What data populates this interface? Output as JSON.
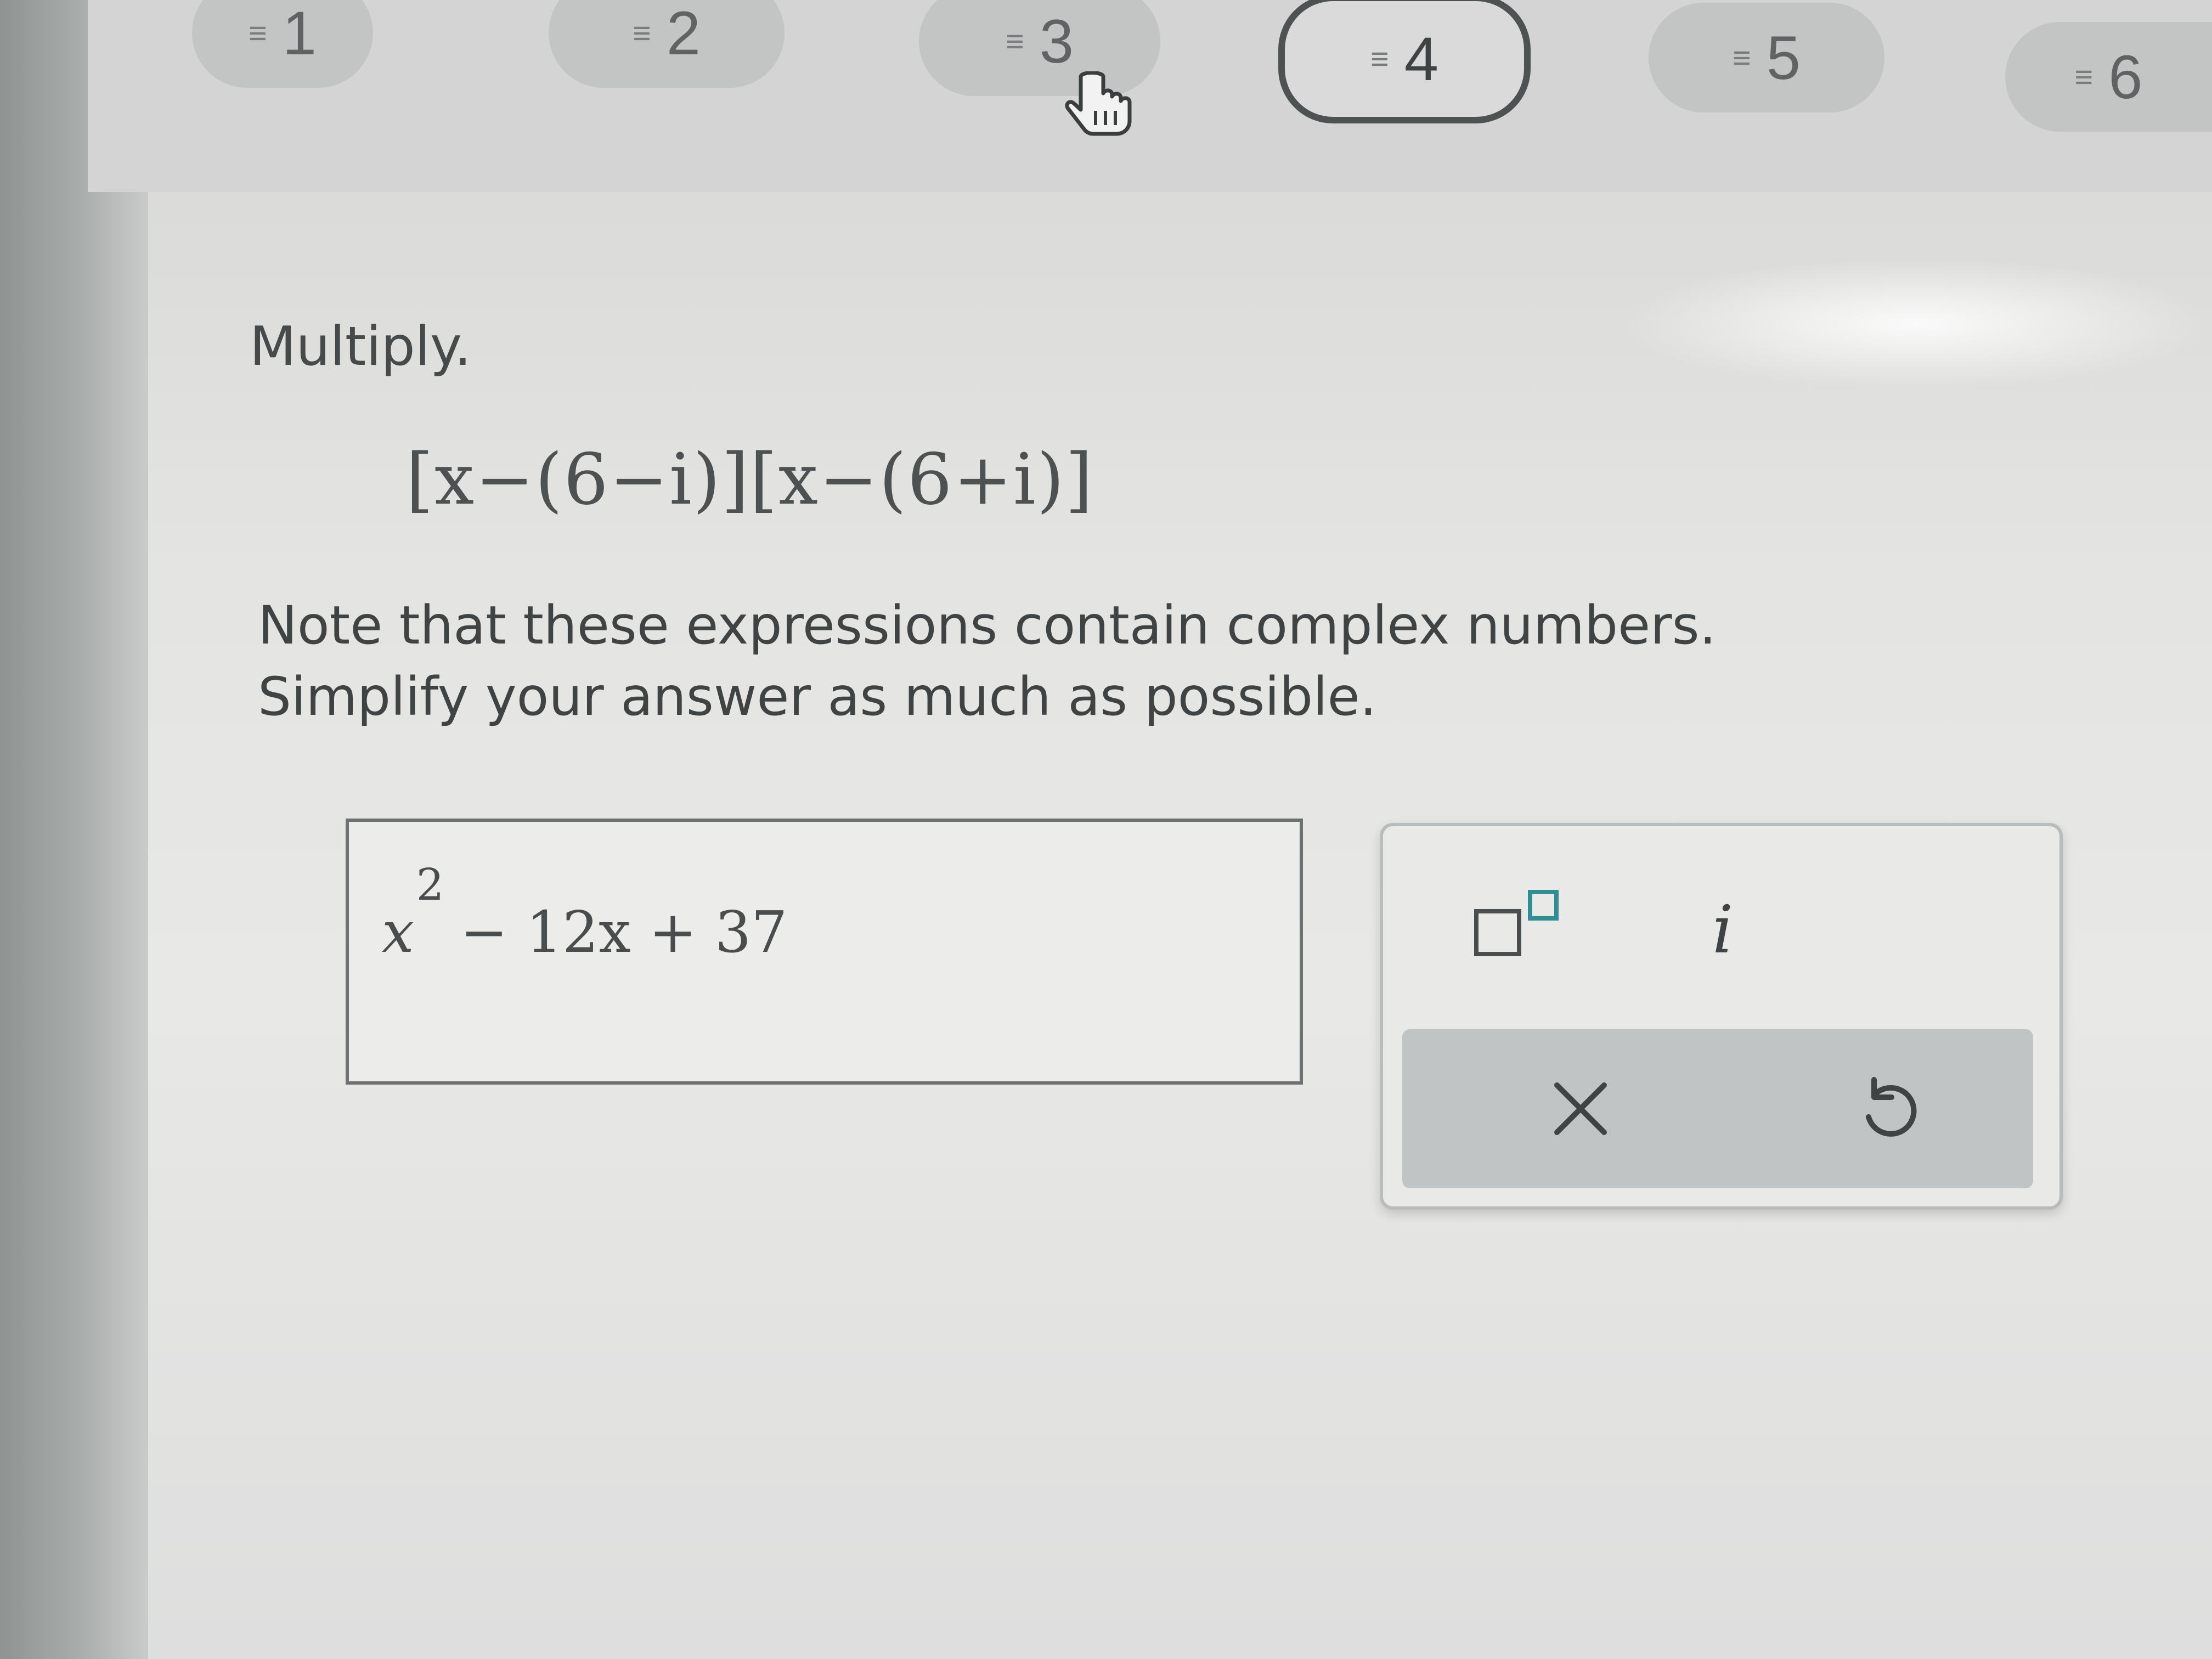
{
  "question_nav": {
    "items": [
      {
        "lines_icon": "≡",
        "number": "1"
      },
      {
        "lines_icon": "≡",
        "number": "2"
      },
      {
        "lines_icon": "≡",
        "number": "3"
      },
      {
        "lines_icon": "≡",
        "number": "4"
      },
      {
        "lines_icon": "≡",
        "number": "5"
      },
      {
        "lines_icon": "≡",
        "number": "6"
      }
    ],
    "active": "4"
  },
  "question": {
    "prompt": "Multiply.",
    "expression": "[x−(6−i)][x−(6+i)]",
    "note_line1": "Note that these expressions contain complex numbers.",
    "note_line2": "Simplify your answer as much as possible."
  },
  "answer": {
    "base": "x",
    "exponent": "2",
    "rest": " − 12x + 37"
  },
  "toolpad": {
    "imaginary_label": "i",
    "icons": [
      "superscript-template-icon",
      "clear-x-icon",
      "undo-icon",
      "hand-pointer-icon"
    ]
  },
  "colors": {
    "teal_accent": "#2e8d95",
    "active_border": "#4e5253"
  }
}
